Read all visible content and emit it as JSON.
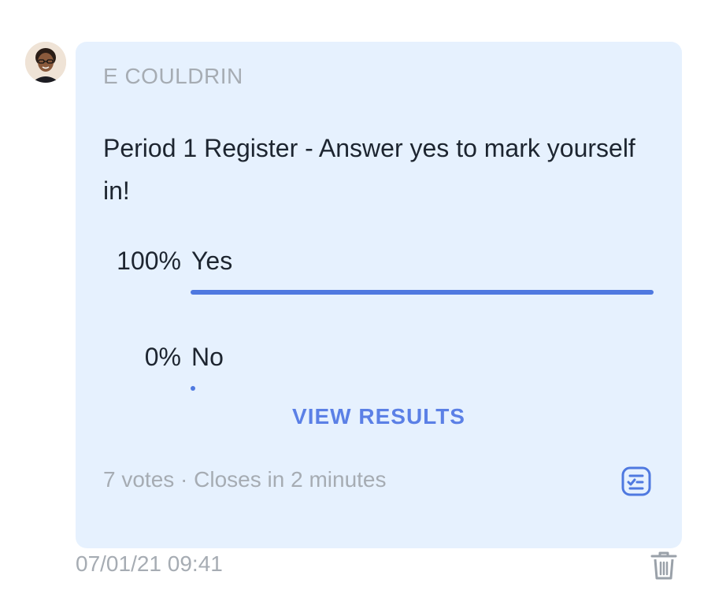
{
  "message": {
    "author": "E COULDRIN",
    "avatar_icon": "user-avatar",
    "timestamp": "07/01/21 09:41"
  },
  "poll": {
    "question": "Period 1 Register - Answer yes to mark yourself in!",
    "options": [
      {
        "percent": "100%",
        "label": "Yes",
        "fraction": 1.0
      },
      {
        "percent": "0%",
        "label": "No",
        "fraction": 0.0
      }
    ],
    "view_results_label": "VIEW RESULTS",
    "meta": "7 votes · Closes in 2 minutes",
    "poll_icon": "poll-checklist-icon"
  },
  "actions": {
    "delete_icon": "trash-icon"
  },
  "colors": {
    "card_background": "#e6f1fe",
    "accent": "#4f79e0",
    "link": "#5b80e6",
    "muted_text": "#a6acb3",
    "primary_text": "#1d2530"
  }
}
